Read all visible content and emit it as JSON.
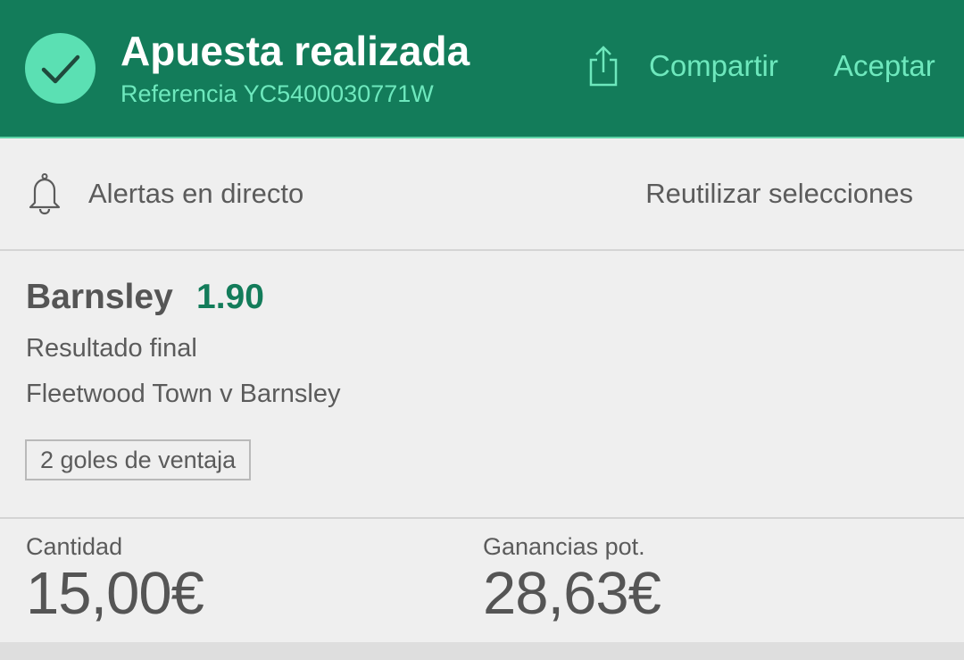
{
  "header": {
    "title": "Apuesta realizada",
    "reference": "Referencia YC5400030771W",
    "share_label": "Compartir",
    "accept_label": "Aceptar",
    "icons": [
      "checkmark-icon",
      "share-icon"
    ],
    "colors": {
      "background": "#137c5a",
      "accent": "#6ee8bd",
      "check_circle": "#5be0b3"
    }
  },
  "alerts": {
    "label": "Alertas en directo",
    "reuse_label": "Reutilizar selecciones",
    "icon": "bell-icon"
  },
  "selection": {
    "name": "Barnsley",
    "odds": "1.90",
    "market": "Resultado final",
    "event": "Fleetwood Town v Barnsley",
    "tag": "2 goles de ventaja",
    "odds_color": "#137c5a"
  },
  "summary": {
    "stake_label": "Cantidad",
    "stake_value": "15,00€",
    "winnings_label": "Ganancias pot.",
    "winnings_value": "28,63€"
  }
}
